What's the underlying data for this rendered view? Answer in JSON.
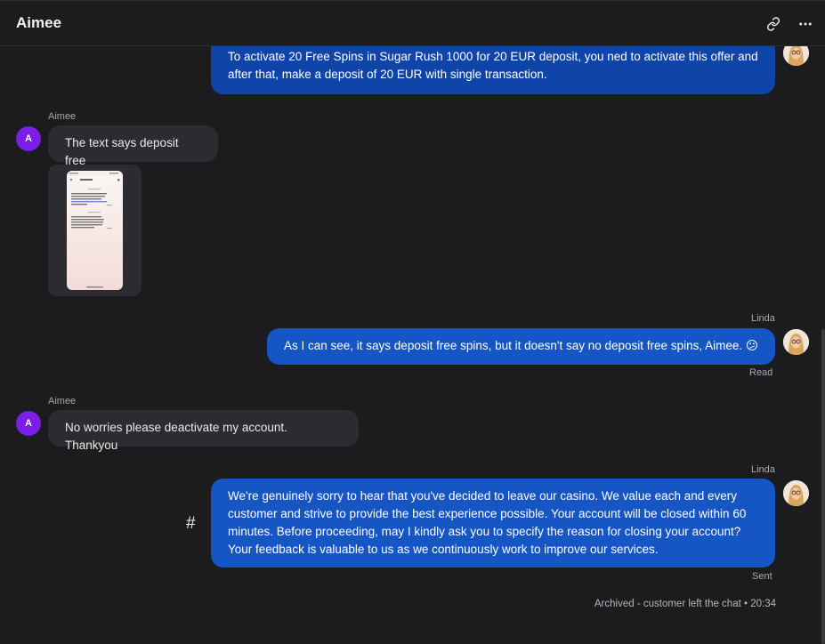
{
  "header": {
    "title": "Aimee",
    "link_icon": "link-icon",
    "more_icon": "more-horizontal-icon"
  },
  "messages": {
    "m1": {
      "text": "To activate 20 Free Spins in Sugar Rush 1000 for 20 EUR deposit, you ned to activate this offer and after that, make a deposit of 20 EUR with single transaction."
    },
    "m2": {
      "sender": "Aimee",
      "avatar_letter": "A",
      "text": "The text says deposit free"
    },
    "m3": {
      "type": "image-attachment",
      "icon": "phone-screenshot-thumbnail"
    },
    "m4": {
      "sender": "Linda",
      "text": "As I can see, it says deposit free spins, but it doesn't say no deposit free spins, Aimee. 😕",
      "status": "Read"
    },
    "m5": {
      "sender": "Aimee",
      "avatar_letter": "A",
      "text": "No worries please deactivate my account. Thankyou"
    },
    "m6": {
      "sender": "Linda",
      "text": "We're genuinely sorry to hear that you've decided to leave our casino. We value each and every customer and strive to provide the best experience possible. Your account will be closed within 60 minutes. Before proceeding, may I kindly ask you to specify the reason for closing your account? Your feedback is valuable to us as we continuously work to improve our services.",
      "status": "Sent"
    }
  },
  "hash_symbol": "#",
  "footer": {
    "archived": "Archived - customer left the chat • 20:34"
  },
  "colors": {
    "background": "#1c1c1e",
    "outgoing_bubble": "#1656c4",
    "incoming_bubble": "#2c2c30",
    "customer_avatar": "#7d1de8"
  }
}
